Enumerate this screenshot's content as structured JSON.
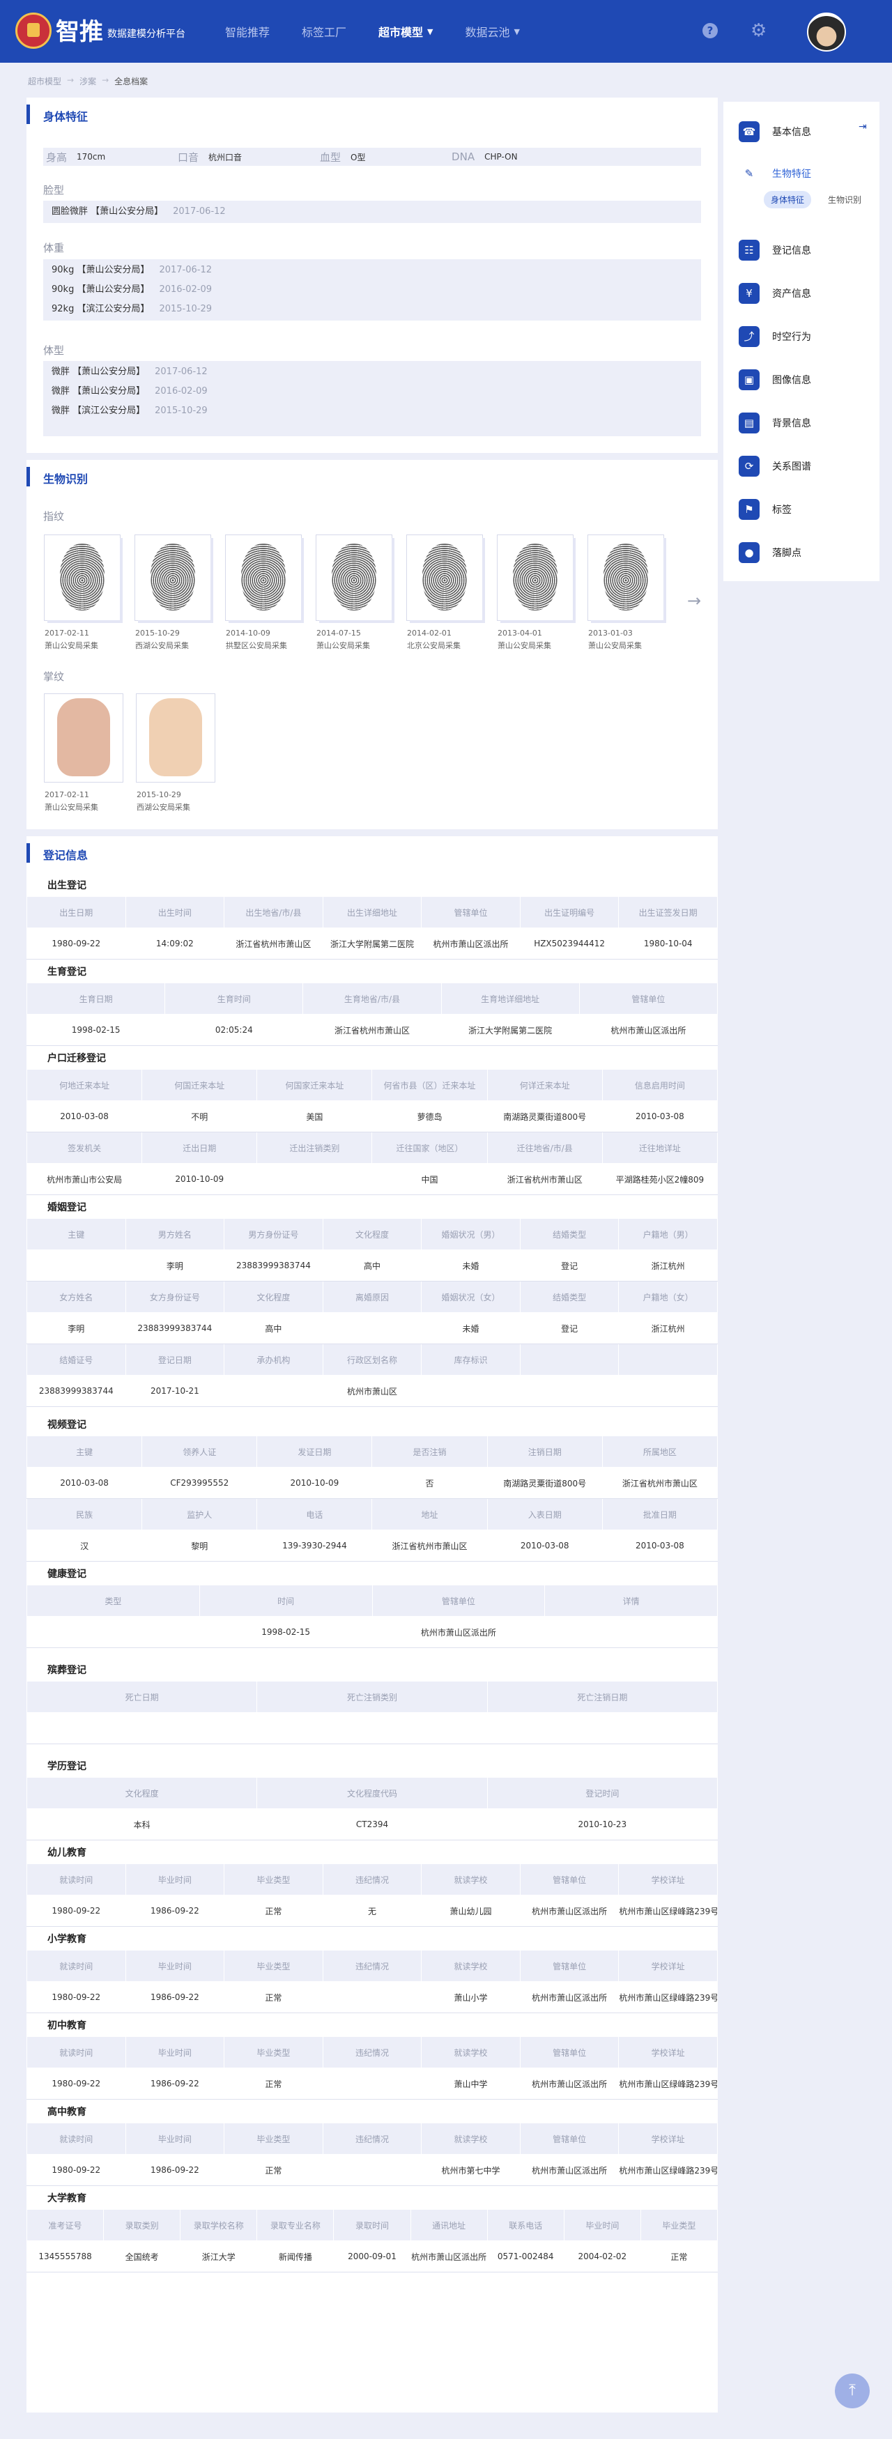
{
  "header": {
    "brand": "智推",
    "subtitle": "数据建模分析平台",
    "nav": [
      "智能推荐",
      "标签工厂",
      "超市模型",
      "数据云池"
    ],
    "active_nav": "超市模型"
  },
  "breadcrumb": [
    "超市模型",
    "涉案",
    "全息档案"
  ],
  "physical": {
    "title": "身体特征",
    "height_label": "身高",
    "height_value": "170cm",
    "accent_label": "口音",
    "accent_value": "杭州口音",
    "blood_label": "血型",
    "blood_value": "O型",
    "dna_label": "DNA",
    "dna_value": "CHP-ON",
    "face_label": "脸型",
    "face_items": [
      {
        "text": "圆脸微胖 【萧山公安分局】",
        "date": "2017-06-12"
      }
    ],
    "weight_label": "体重",
    "weight_items": [
      {
        "text": "90kg 【萧山公安分局】",
        "date": "2017-06-12"
      },
      {
        "text": "90kg 【萧山公安分局】",
        "date": "2016-02-09"
      },
      {
        "text": "92kg 【滨江公安分局】",
        "date": "2015-10-29"
      }
    ],
    "build_label": "体型",
    "build_items": [
      {
        "text": "微胖 【萧山公安分局】",
        "date": "2017-06-12"
      },
      {
        "text": "微胖 【萧山公安分局】",
        "date": "2016-02-09"
      },
      {
        "text": "微胖 【滨江公安分局】",
        "date": "2015-10-29"
      }
    ]
  },
  "bio": {
    "title": "生物识别",
    "fingerprint_label": "指纹",
    "fingerprints": [
      {
        "date": "2017-02-11",
        "src": "萧山公安局采集"
      },
      {
        "date": "2015-10-29",
        "src": "西湖公安局采集"
      },
      {
        "date": "2014-10-09",
        "src": "拱墅区公安局采集"
      },
      {
        "date": "2014-07-15",
        "src": "萧山公安局采集"
      },
      {
        "date": "2014-02-01",
        "src": "北京公安局采集"
      },
      {
        "date": "2013-04-01",
        "src": "萧山公安局采集"
      },
      {
        "date": "2013-01-03",
        "src": "萧山公安局采集"
      }
    ],
    "palm_label": "掌纹",
    "palms": [
      {
        "date": "2017-02-11",
        "src": "萧山公安局采集"
      },
      {
        "date": "2015-10-29",
        "src": "西湖公安局采集"
      }
    ]
  },
  "registration": {
    "title": "登记信息",
    "birth": {
      "title": "出生登记",
      "headers": [
        "出生日期",
        "出生时间",
        "出生地省/市/县",
        "出生详细地址",
        "管辖单位",
        "出生证明编号",
        "出生证签发日期"
      ],
      "values": [
        "1980-09-22",
        "14:09:02",
        "浙江省杭州市萧山区",
        "浙江大学附属第二医院",
        "杭州市萧山区派出所",
        "HZX5023944412",
        "1980-10-04"
      ]
    },
    "fertility": {
      "title": "生育登记",
      "headers": [
        "生育日期",
        "生育时间",
        "生育地省/市/县",
        "生育地详细地址",
        "管辖单位"
      ],
      "values": [
        "1998-02-15",
        "02:05:24",
        "浙江省杭州市萧山区",
        "浙江大学附属第二医院",
        "杭州市萧山区派出所"
      ]
    },
    "migration": {
      "title": "户口迁移登记",
      "headers1": [
        "何地迁来本址",
        "何国迁来本址",
        "何国家迁来本址",
        "何省市县（区）迁来本址",
        "何详迁来本址",
        "信息启用时间"
      ],
      "values1": [
        "2010-03-08",
        "不明",
        "美国",
        "萝德岛",
        "南湖路灵粟街道800号",
        "2010-03-08"
      ],
      "headers2": [
        "签发机关",
        "迁出日期",
        "迁出注销类别",
        "迁往国家（地区）",
        "迁往地省/市/县",
        "迁往地详址"
      ],
      "values2": [
        "杭州市萧山市公安局",
        "2010-10-09",
        "",
        "中国",
        "浙江省杭州市萧山区",
        "平湖路桂苑小区2幢809"
      ]
    },
    "marriage": {
      "title": "婚姻登记",
      "headers1": [
        "主键",
        "男方姓名",
        "男方身份证号",
        "文化程度",
        "婚姻状况（男）",
        "结婚类型",
        "户籍地（男）"
      ],
      "values1": [
        "",
        "李明",
        "23883999383744",
        "高中",
        "未婚",
        "登记",
        "浙江杭州"
      ],
      "headers2": [
        "女方姓名",
        "女方身份证号",
        "文化程度",
        "离婚原因",
        "婚姻状况（女）",
        "结婚类型",
        "户籍地（女）"
      ],
      "values2": [
        "李明",
        "23883999383744",
        "高中",
        "",
        "未婚",
        "登记",
        "浙江杭州"
      ],
      "headers3": [
        "结婚证号",
        "登记日期",
        "承办机构",
        "行政区划名称",
        "库存标识",
        "",
        ""
      ],
      "values3": [
        "23883999383744",
        "2017-10-21",
        "",
        "杭州市萧山区",
        "",
        "",
        ""
      ]
    },
    "guardian": {
      "title": "视频登记",
      "headers1": [
        "主键",
        "领养人证",
        "发证日期",
        "是否注销",
        "注销日期",
        "所属地区"
      ],
      "values1": [
        "2010-03-08",
        "CF293995552",
        "2010-10-09",
        "否",
        "南湖路灵粟街道800号",
        "浙江省杭州市萧山区"
      ],
      "headers2": [
        "民族",
        "监护人",
        "电话",
        "地址",
        "入表日期",
        "批准日期"
      ],
      "values2": [
        "汉",
        "黎明",
        "139-3930-2944",
        "浙江省杭州市萧山区",
        "2010-03-08",
        "2010-03-08"
      ]
    },
    "health": {
      "title": "健康登记",
      "headers": [
        "类型",
        "时间",
        "管辖单位",
        "详情"
      ],
      "values": [
        "",
        "1998-02-15",
        "杭州市萧山区派出所",
        ""
      ]
    },
    "funeral": {
      "title": "殡葬登记",
      "headers": [
        "死亡日期",
        "死亡注销类别",
        "死亡注销日期"
      ],
      "values": [
        "",
        "",
        ""
      ]
    },
    "education": {
      "title": "学历登记",
      "headers": [
        "文化程度",
        "文化程度代码",
        "登记时间"
      ],
      "values": [
        "本科",
        "CT2394",
        "2010-10-23"
      ]
    },
    "school_headers": [
      "就读时间",
      "毕业时间",
      "毕业类型",
      "违纪情况",
      "就读学校",
      "管辖单位",
      "学校详址"
    ],
    "kindergarten": {
      "title": "幼儿教育",
      "values": [
        "1980-09-22",
        "1986-09-22",
        "正常",
        "无",
        "萧山幼儿园",
        "杭州市萧山区派出所",
        "杭州市萧山区绿峰路239号"
      ]
    },
    "primary": {
      "title": "小学教育",
      "values": [
        "1980-09-22",
        "1986-09-22",
        "正常",
        "",
        "萧山小学",
        "杭州市萧山区派出所",
        "杭州市萧山区绿峰路239号"
      ]
    },
    "junior": {
      "title": "初中教育",
      "values": [
        "1980-09-22",
        "1986-09-22",
        "正常",
        "",
        "萧山中学",
        "杭州市萧山区派出所",
        "杭州市萧山区绿峰路239号"
      ]
    },
    "senior": {
      "title": "高中教育",
      "values": [
        "1980-09-22",
        "1986-09-22",
        "正常",
        "",
        "杭州市第七中学",
        "杭州市萧山区派出所",
        "杭州市萧山区绿峰路239号"
      ]
    },
    "university": {
      "title": "大学教育",
      "headers": [
        "准考证号",
        "录取类别",
        "录取学校名称",
        "录取专业名称",
        "录取时间",
        "通讯地址",
        "联系电话",
        "毕业时间",
        "毕业类型"
      ],
      "values": [
        "1345555788",
        "全国统考",
        "浙江大学",
        "新闻传播",
        "2000-09-01",
        "杭州市萧山区派出所",
        "0571-002484",
        "2004-02-02",
        "正常"
      ]
    }
  },
  "sidebar": {
    "items": [
      "基本信息",
      "生物特征",
      "登记信息",
      "资产信息",
      "时空行为",
      "图像信息",
      "背景信息",
      "关系图谱",
      "标签",
      "落脚点"
    ],
    "active": "生物特征",
    "tabs": [
      "身体特征",
      "生物识别"
    ]
  }
}
